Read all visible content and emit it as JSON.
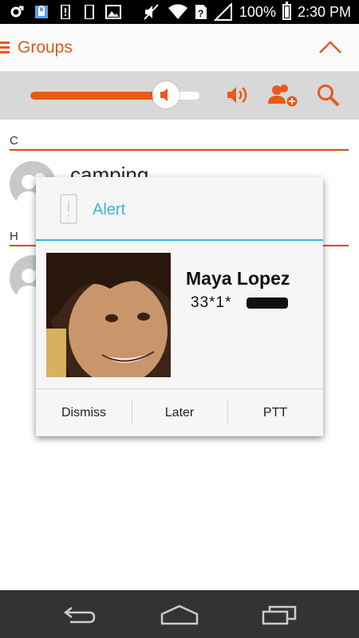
{
  "status_bar": {
    "battery_percent": "100%",
    "time": "2:30 PM",
    "icons": [
      "link-icon",
      "lock-icon",
      "phone-alert-icon",
      "phone-icon",
      "image-icon",
      "mute-icon",
      "wifi-icon",
      "sim-icon",
      "signal-icon",
      "battery-icon"
    ]
  },
  "action_bar": {
    "title": "Groups",
    "accent_color": "#e05a1f"
  },
  "controls": {
    "volume_level": 0.8
  },
  "list": {
    "sections": [
      {
        "header": "C",
        "groups": [
          {
            "name": "camping"
          }
        ]
      },
      {
        "header": "H",
        "groups": [
          {
            "name": ""
          }
        ]
      }
    ]
  },
  "alert_dialog": {
    "title": "Alert",
    "caller_name": "Maya Lopez",
    "caller_number": "33*1*",
    "buttons": {
      "dismiss": "Dismiss",
      "later": "Later",
      "ptt": "PTT"
    },
    "accent_color": "#33b5e5"
  },
  "nav_bar": {
    "icons": [
      "back-icon",
      "home-icon",
      "recent-apps-icon"
    ]
  }
}
